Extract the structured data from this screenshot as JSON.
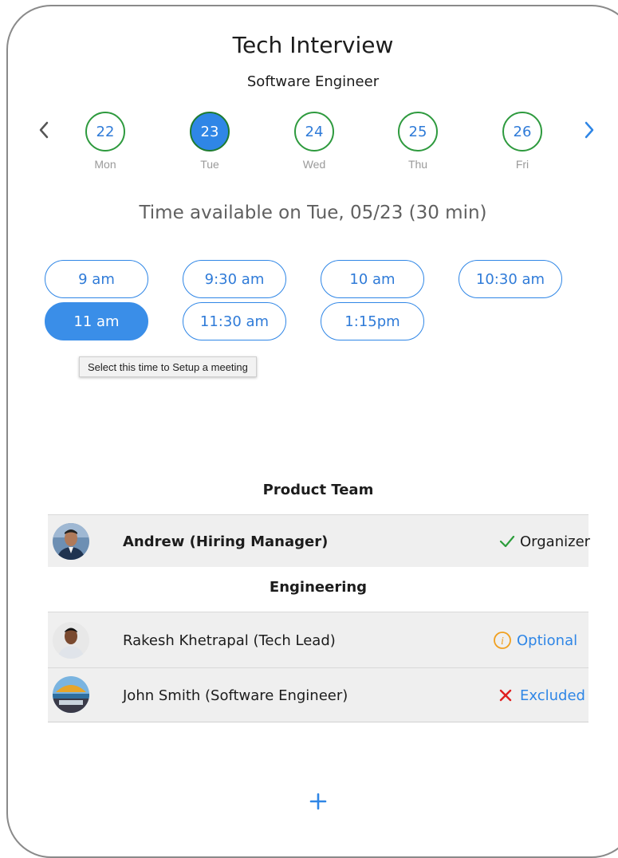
{
  "header": {
    "title": "Tech Interview",
    "subtitle": "Software Engineer"
  },
  "date_strip": {
    "days": [
      {
        "num": "22",
        "name": "Mon"
      },
      {
        "num": "23",
        "name": "Tue",
        "selected": true
      },
      {
        "num": "24",
        "name": "Wed"
      },
      {
        "num": "25",
        "name": "Thu"
      },
      {
        "num": "26",
        "name": "Fri"
      }
    ]
  },
  "availability_heading": "Time available on Tue, 05/23 (30 min)",
  "time_slots": [
    {
      "label": "9 am"
    },
    {
      "label": "9:30 am"
    },
    {
      "label": "10 am"
    },
    {
      "label": "10:30 am"
    },
    {
      "label": "11 am",
      "selected": true
    },
    {
      "label": "11:30 am"
    },
    {
      "label": "1:15pm"
    }
  ],
  "tooltip": "Select this time to Setup a meeting",
  "teams": [
    {
      "name": "Product Team",
      "members": [
        {
          "name": "Andrew (Hiring Manager)",
          "status": "Organizer",
          "status_icon": "check-icon"
        }
      ]
    },
    {
      "name": "Engineering",
      "members": [
        {
          "name": "Rakesh Khetrapal (Tech Lead)",
          "status": "Optional",
          "status_icon": "info-icon"
        },
        {
          "name": "John Smith (Software Engineer)",
          "status": "Excluded",
          "status_icon": "x-icon"
        }
      ]
    }
  ],
  "colors": {
    "accent": "#2f86e6",
    "day_border": "#2e9a3e",
    "check": "#2a9d3a",
    "optional": "#f0a020",
    "excluded": "#e02020"
  }
}
